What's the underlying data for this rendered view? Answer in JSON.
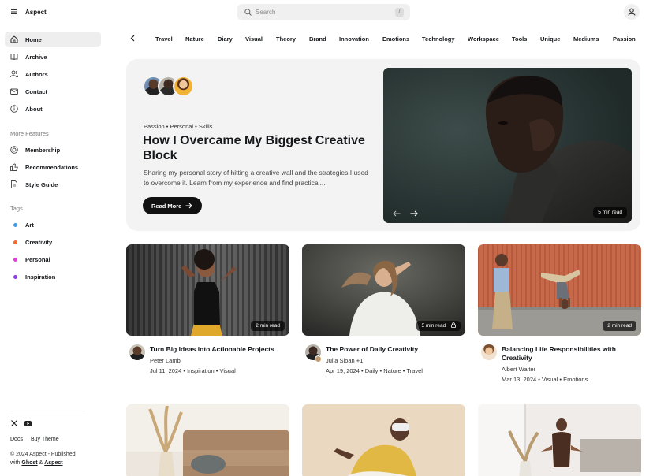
{
  "app": {
    "name": "Aspect"
  },
  "search": {
    "placeholder": "Search",
    "shortcut": "/"
  },
  "sidebar": {
    "nav": [
      {
        "label": "Home",
        "icon": "home-icon",
        "active": true
      },
      {
        "label": "Archive",
        "icon": "book-icon"
      },
      {
        "label": "Authors",
        "icon": "users-icon"
      },
      {
        "label": "Contact",
        "icon": "mail-icon"
      },
      {
        "label": "About",
        "icon": "info-icon"
      }
    ],
    "features_heading": "More Features",
    "features": [
      {
        "label": "Membership",
        "icon": "dollar-icon"
      },
      {
        "label": "Recommendations",
        "icon": "thumbs-up-icon"
      },
      {
        "label": "Style Guide",
        "icon": "document-icon"
      }
    ],
    "tags_heading": "Tags",
    "tags": [
      {
        "label": "Art",
        "color": "#3b9ce8"
      },
      {
        "label": "Creativity",
        "color": "#f36b2b"
      },
      {
        "label": "Personal",
        "color": "#e83ad8"
      },
      {
        "label": "Inspiration",
        "color": "#8f3ae8"
      }
    ],
    "footer": {
      "links": [
        "Docs",
        "Buy Theme"
      ],
      "copyright_line1": "© 2024 Aspect - Published",
      "copyright_with": "with",
      "ghost": "Ghost",
      "amp": "&",
      "aspect": "Aspect"
    }
  },
  "tabs": [
    "Travel",
    "Nature",
    "Diary",
    "Visual",
    "Theory",
    "Brand",
    "Innovation",
    "Emotions",
    "Technology",
    "Workspace",
    "Tools",
    "Unique",
    "Mediums",
    "Passion"
  ],
  "hero": {
    "tags": [
      "Passion",
      "Personal",
      "Skills"
    ],
    "tags_text": "Passion • Personal • Skills",
    "title": "How I Overcame My Biggest Creative Block",
    "excerpt": "Sharing my personal story of hitting a creative wall and the strategies I used to overcome it. Learn from my experience and find practical...",
    "button": "Read More",
    "read_time": "5 min read"
  },
  "cards": [
    {
      "title": "Turn Big Ideas into Actionable Projects",
      "author": "Peter Lamb",
      "meta": "Jul 11, 2024 • Inspiration • Visual",
      "read_time": "2 min read",
      "locked": false
    },
    {
      "title": "The Power of Daily Creativity",
      "author": "Julia Sloan +1",
      "meta": "Apr 19, 2024 • Daily • Nature • Travel",
      "read_time": "5 min read",
      "locked": true
    },
    {
      "title": "Balancing Life Responsibilities with Creativity",
      "author": "Albert Walter",
      "meta": "Mar 13, 2024 • Visual • Emotions",
      "read_time": "2 min read",
      "locked": false
    }
  ]
}
